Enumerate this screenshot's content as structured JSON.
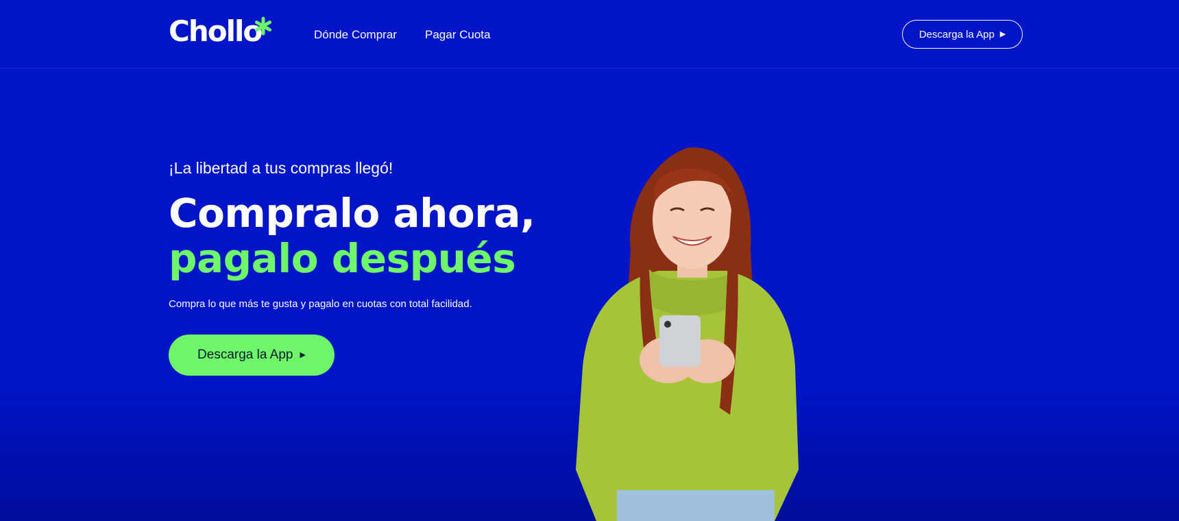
{
  "brand": {
    "name": "Chollo",
    "accent_color": "#6ff56a",
    "background_color": "#0014c8"
  },
  "nav": {
    "links": [
      "Dónde Comprar",
      "Pagar Cuota"
    ],
    "cta_label": "Descarga la App"
  },
  "hero": {
    "tagline": "¡La libertad a tus compras llegó!",
    "headline_line1": "Compralo ahora,",
    "headline_line2": "pagalo después",
    "subtitle": "Compra lo que más te gusta y pagalo en cuotas con total facilidad.",
    "cta_label": "Descarga la App"
  },
  "icons": {
    "logo_mark": "asterisk-icon",
    "cta_arrow": "play-triangle-icon"
  }
}
